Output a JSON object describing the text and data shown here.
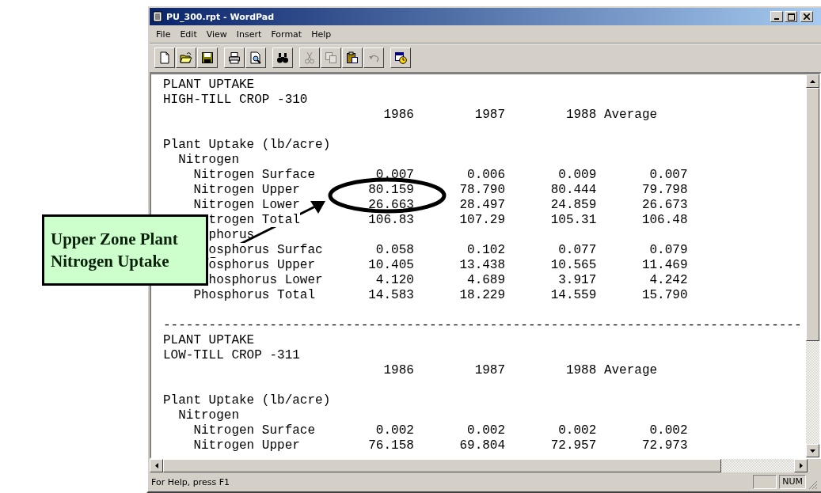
{
  "window": {
    "title": "PU_300.rpt - WordPad"
  },
  "menu": [
    "File",
    "Edit",
    "View",
    "Insert",
    "Format",
    "Help"
  ],
  "toolbar": [
    [
      {
        "kind": "new",
        "disabled": false
      },
      {
        "kind": "open",
        "disabled": false
      },
      {
        "kind": "save",
        "disabled": false
      }
    ],
    [
      {
        "kind": "print",
        "disabled": false
      },
      {
        "kind": "preview",
        "disabled": false
      }
    ],
    [
      {
        "kind": "find",
        "disabled": false
      }
    ],
    [
      {
        "kind": "cut",
        "disabled": true
      },
      {
        "kind": "copy",
        "disabled": true
      },
      {
        "kind": "paste",
        "disabled": false
      },
      {
        "kind": "undo",
        "disabled": true
      }
    ],
    [
      {
        "kind": "datetime",
        "disabled": false
      }
    ]
  ],
  "document": {
    "blocks": [
      {
        "kind": "section",
        "title": "PLANT UPTAKE",
        "subtitle": "HIGH-TILL CROP -310",
        "columns": [
          "1986",
          "1987",
          "1988",
          "Average"
        ],
        "heading": "Plant Uptake (lb/acre)",
        "groups": [
          {
            "name": "Nitrogen",
            "covered": false,
            "children": [
              {
                "label": "Nitrogen Surface",
                "covered": false,
                "values": [
                  "0.007",
                  "0.006",
                  "0.009",
                  "0.007"
                ]
              },
              {
                "label": "Nitrogen Upper",
                "covered": false,
                "values": [
                  "80.159",
                  "78.790",
                  "80.444",
                  "79.798"
                ]
              },
              {
                "label": "Nitrogen Lower",
                "covered": false,
                "values": [
                  "26.663",
                  "28.497",
                  "24.859",
                  "26.673"
                ]
              },
              {
                "label": "trogen Total",
                "covered": true,
                "values": [
                  "106.83",
                  "107.29",
                  "105.31",
                  "106.48"
                ]
              }
            ]
          },
          {
            "name": "phorus",
            "covered": true,
            "children": [
              {
                "label": "osphorus Surfac",
                "covered": true,
                "values": [
                  "0.058",
                  "0.102",
                  "0.077",
                  "0.079"
                ]
              },
              {
                "label": "osphorus Upper",
                "covered": true,
                "values": [
                  "10.405",
                  "13.438",
                  "10.565",
                  "11.469"
                ]
              },
              {
                "label": "hosphorus Lower",
                "covered": true,
                "values": [
                  "4.120",
                  "4.689",
                  "3.917",
                  "4.242"
                ]
              },
              {
                "label": "Phosphorus Total",
                "covered": false,
                "values": [
                  "14.583",
                  "18.229",
                  "14.559",
                  "15.790"
                ]
              }
            ]
          }
        ]
      },
      {
        "kind": "separator",
        "text": "------------------------------------------------------------------------------------"
      },
      {
        "kind": "section",
        "title": "PLANT UPTAKE",
        "subtitle": "LOW-TILL CROP -311",
        "columns": [
          "1986",
          "1987",
          "1988",
          "Average"
        ],
        "heading": "Plant Uptake (lb/acre)",
        "groups": [
          {
            "name": "Nitrogen",
            "covered": false,
            "children": [
              {
                "label": "Nitrogen Surface",
                "covered": false,
                "values": [
                  "0.002",
                  "0.002",
                  "0.002",
                  "0.002"
                ]
              },
              {
                "label": "Nitrogen Upper",
                "covered": false,
                "values": [
                  "76.158",
                  "69.804",
                  "72.957",
                  "72.973"
                ]
              }
            ]
          }
        ]
      }
    ]
  },
  "callout": {
    "text": "Upper Zone Plant Nitrogen Uptake"
  },
  "status_bar": {
    "text": "For Help, press F1",
    "indicators": [
      {
        "label": "NUM"
      }
    ]
  }
}
